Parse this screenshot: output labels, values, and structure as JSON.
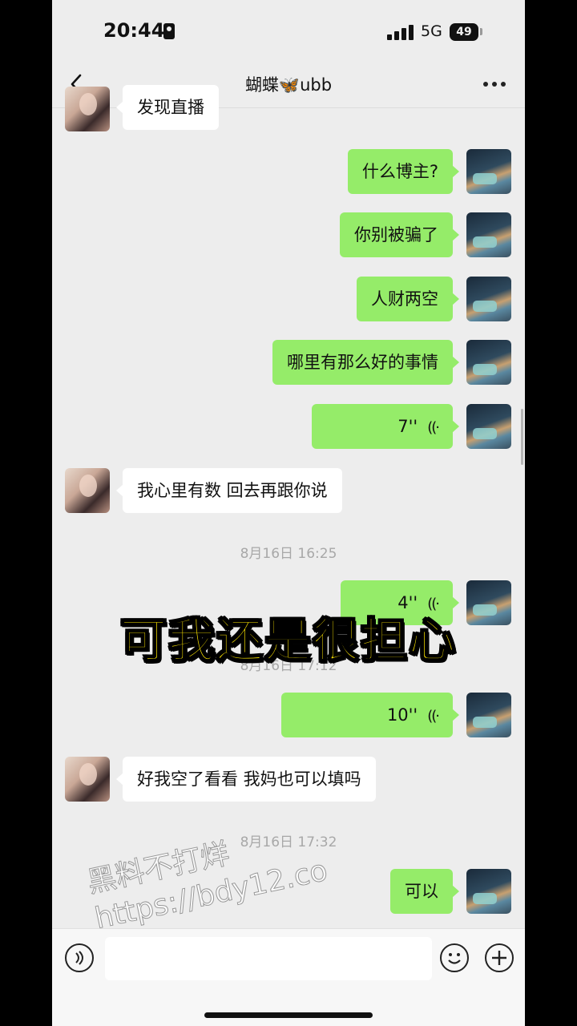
{
  "status_bar": {
    "time": "20:44",
    "network": "5G",
    "battery": "49"
  },
  "header": {
    "title": "蝴蝶🦋ubb"
  },
  "messages": {
    "m0": "发现直播",
    "m1": "什么博主?",
    "m2": "你别被骗了",
    "m3": "人财两空",
    "m4": "哪里有那么好的事情",
    "m5_duration": "7''",
    "m6": "我心里有数 回去再跟你说",
    "ts1": "8月16日 16:25",
    "m7_duration": "4''",
    "ts2": "8月16日 17:12",
    "m8_duration": "10''",
    "m9": "好我空了看看 我妈也可以填吗",
    "ts3": "8月16日 17:32",
    "m10": "可以"
  },
  "overlay": {
    "caption": "可我还是很担心"
  },
  "watermark": {
    "line1": "黑料不打烊",
    "line2": "https://bdy12.co"
  },
  "colors": {
    "my_bubble": "#95ec69",
    "their_bubble": "#ffffff",
    "chat_bg": "#ededed",
    "caption": "#ffe700"
  },
  "icons": [
    "back-chevron-icon",
    "more-icon",
    "voice-wave-icon",
    "voice-input-icon",
    "emoji-icon",
    "plus-icon"
  ]
}
